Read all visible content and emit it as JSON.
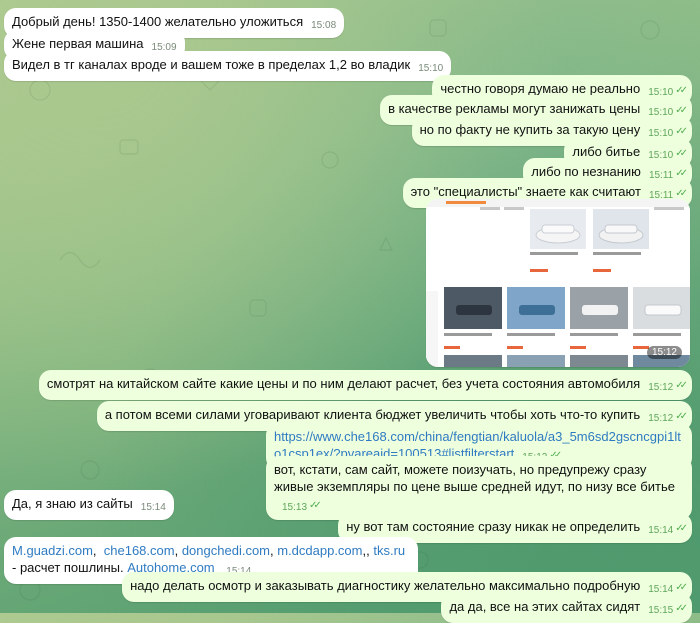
{
  "messages": [
    {
      "id": "m1",
      "dir": "in",
      "text": "Добрый день! 1350-1400 желательно уложиться",
      "time": "15:08"
    },
    {
      "id": "m2",
      "dir": "in",
      "text": "Жене первая машина",
      "time": "15:09"
    },
    {
      "id": "m3",
      "dir": "in",
      "text": "Видел в тг каналах вроде и вашем тоже в пределах 1,2 во владик",
      "time": "15:10"
    },
    {
      "id": "m4",
      "dir": "out",
      "text": "честно говоря думаю не реально",
      "time": "15:10"
    },
    {
      "id": "m5",
      "dir": "out",
      "text": "в качестве рекламы могут занижать цены",
      "time": "15:10"
    },
    {
      "id": "m6",
      "dir": "out",
      "text": "но по факту не купить за такую цену",
      "time": "15:10"
    },
    {
      "id": "m7",
      "dir": "out",
      "text": "либо битье",
      "time": "15:10"
    },
    {
      "id": "m8",
      "dir": "out",
      "text": "либо по незнанию",
      "time": "15:11"
    },
    {
      "id": "m9",
      "dir": "out",
      "text": "это \"специалисты\" знаете как считают",
      "time": "15:11"
    },
    {
      "id": "m10",
      "dir": "out",
      "type": "photo",
      "time": "15:12"
    },
    {
      "id": "m11",
      "dir": "out",
      "text": "смотрят на китайском сайте какие цены и по ним делают расчет, без учета состояния автомобиля",
      "time": "15:12"
    },
    {
      "id": "m12",
      "dir": "out",
      "text": "а потом всеми силами уговаривают клиента бюджет увеличить чтобы хоть что-то купить",
      "time": "15:12"
    },
    {
      "id": "m13",
      "dir": "out",
      "link": "https://www.che168.com/china/fengtian/kaluola/a3_5m6sd2gscncgpi1lto1csp1ex/?pvareaid=100513#listfilterstart",
      "time": "15:12"
    },
    {
      "id": "m14",
      "dir": "out",
      "text": "вот, кстати, сам сайт, можете поизучать, но предупрежу сразу живые экземпляры по цене выше средней идут, по низу все битье",
      "time": "15:13"
    },
    {
      "id": "m15",
      "dir": "in",
      "text": "Да, я знаю из сайты",
      "time": "15:14"
    },
    {
      "id": "m16",
      "dir": "out",
      "text": "ну вот там состояние сразу никак не определить",
      "time": "15:14"
    },
    {
      "id": "m17",
      "dir": "in",
      "links": [
        "M.guadzi.com",
        "che168.com",
        "dongchedi.com",
        "m.dcdapp.com",
        "tks.ru",
        "Autohome.com"
      ],
      "suffix": " - расчет пошлины.",
      "time": "15:14"
    },
    {
      "id": "m18",
      "dir": "out",
      "text": "надо делать осмотр и заказывать диагностику желательно максимально подробную",
      "time": "15:14"
    },
    {
      "id": "m19",
      "dir": "out",
      "text": "да да, все на этих сайтах сидят",
      "time": "15:15"
    }
  ],
  "photo": {
    "tabs": [
      "Special offer",
      "More options"
    ],
    "top_cards": [
      {
        "title": "Corolla 2021 1.2T 4L CVT Elite Edition",
        "price": "42,000"
      },
      {
        "title": "Corolla 2021 1.2T 4L CVT Smart Edition",
        "price": "43,000"
      }
    ],
    "grid_cards": [
      {
        "title": "Corolla 2021 1.2T CVT Pro Jin Edition",
        "price": "46,000"
      },
      {
        "title": "Corolla 2021 1.2T CVT Sports Edition",
        "price": "45,000"
      },
      {
        "title": "Corolla 2021 1.2T 4L CVT Elite Edition",
        "price": "46,000"
      },
      {
        "title": "Corolla 2021 1.2T CVT Premium Edition",
        "price": "48,000"
      }
    ]
  },
  "colors": {
    "incoming": "#ffffff",
    "outgoing": "#eeffde",
    "link": "#2f7bc2",
    "time_out": "#5fa65a"
  }
}
